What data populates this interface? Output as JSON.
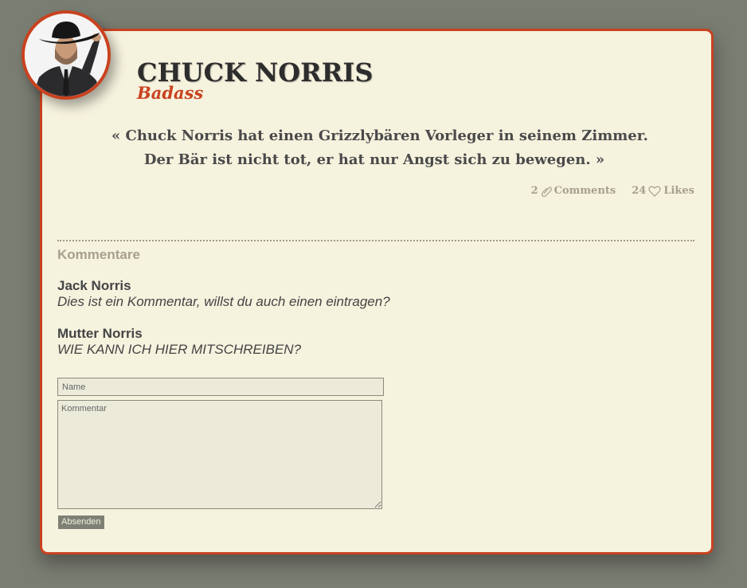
{
  "profile": {
    "name": "CHUCK NORRIS",
    "subtitle": "Badass",
    "avatar_icon": "cowboy-portrait-icon"
  },
  "quote": {
    "line1": "« Chuck Norris hat einen Grizzlybären Vorleger in seinem Zimmer.",
    "line2": "Der Bär ist nicht tot, er hat nur Angst sich zu bewegen. »"
  },
  "meta": {
    "comments_count": "2",
    "comments_label": "Comments",
    "comments_icon": "paperclip-icon",
    "likes_count": "24",
    "likes_label": "Likes",
    "likes_icon": "heart-icon"
  },
  "comments_section": {
    "title": "Kommentare",
    "comments": [
      {
        "author": "Jack Norris",
        "text": "Dies ist ein Kommentar, willst du auch einen eintragen?"
      },
      {
        "author": "Mutter Norris",
        "text": "WIE KANN ICH HIER MITSCHREIBEN?"
      }
    ]
  },
  "form": {
    "name_placeholder": "Name",
    "comment_placeholder": "Kommentar",
    "submit_label": "Absenden"
  },
  "colors": {
    "background": "#7a7d72",
    "card": "#f5f2de",
    "accent": "#c9421f",
    "muted": "#a89f8e"
  }
}
